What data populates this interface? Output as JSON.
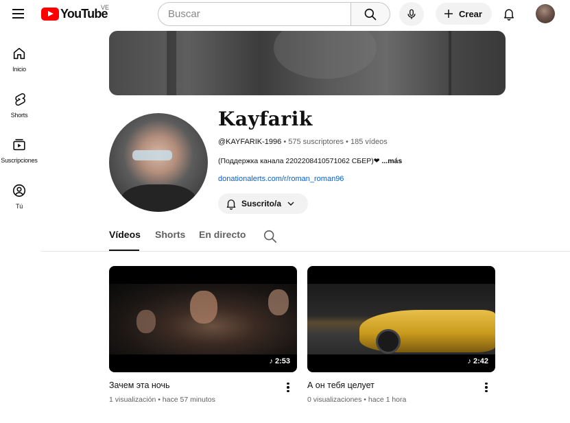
{
  "header": {
    "logo_text": "YouTube",
    "country_code": "VE",
    "search_placeholder": "Buscar",
    "create_label": "Crear"
  },
  "sidebar": {
    "items": [
      {
        "label": "Inicio",
        "icon": "home-icon"
      },
      {
        "label": "Shorts",
        "icon": "shorts-icon"
      },
      {
        "label": "Suscripciones",
        "icon": "subscriptions-icon"
      },
      {
        "label": "Tú",
        "icon": "user-icon"
      }
    ]
  },
  "channel": {
    "name": "Kayfarik",
    "handle": "@KAYFARIK-1996",
    "subscribers": "575 suscriptores",
    "videos_count": "185 vídeos",
    "separator": "•",
    "description": "(Поддержка канала 2202208410571062 СБЕР)❤",
    "more_label": "...más",
    "link": "donationalerts.com/r/roman_roman96",
    "subscribe_label": "Suscrito/a"
  },
  "tabs": [
    {
      "label": "Vídeos",
      "active": true
    },
    {
      "label": "Shorts",
      "active": false
    },
    {
      "label": "En directo",
      "active": false
    }
  ],
  "videos": [
    {
      "title": "Зачем эта ночь",
      "duration": "2:53",
      "views": "1 visualización",
      "age": "hace 57 minutos",
      "meta": "1 visualización • hace 57 minutos"
    },
    {
      "title": "А он тебя целует",
      "duration": "2:42",
      "views": "0 visualizaciones",
      "age": "hace 1 hora",
      "meta": "0 visualizaciones • hace 1 hora"
    }
  ],
  "colors": {
    "brand_red": "#ff0000",
    "link_blue": "#065fd4",
    "text_primary": "#0f0f0f",
    "text_secondary": "#606060"
  }
}
